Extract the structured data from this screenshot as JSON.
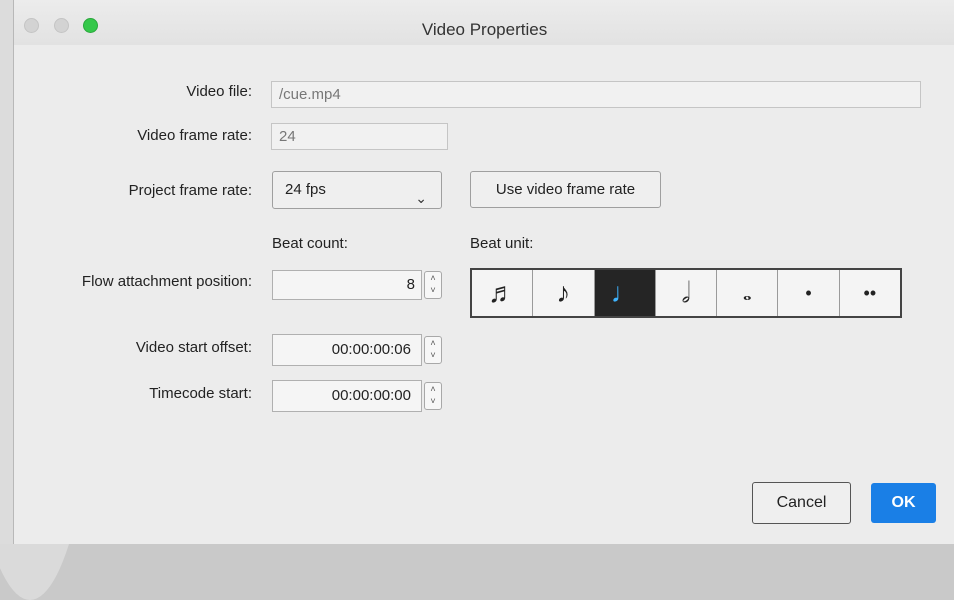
{
  "window": {
    "title": "Video Properties"
  },
  "form": {
    "video_file_label": "Video file:",
    "video_file_value": "/cue.mp4",
    "video_frame_rate_label": "Video frame rate:",
    "video_frame_rate_value": "24",
    "project_frame_rate_label": "Project frame rate:",
    "project_frame_rate_value": "24 fps",
    "use_video_frame_rate_button": "Use video frame rate",
    "beat_count_label": "Beat count:",
    "beat_unit_label": "Beat unit:",
    "flow_attachment_label": "Flow attachment position:",
    "flow_attachment_value": "8",
    "video_start_offset_label": "Video start offset:",
    "video_start_offset_value": "00:00:00:06",
    "timecode_start_label": "Timecode start:",
    "timecode_start_value": "00:00:00:00"
  },
  "beat_units": [
    {
      "name": "sixteenth-note-icon",
      "glyph": "♬",
      "active": false
    },
    {
      "name": "eighth-note-icon",
      "glyph": "♪",
      "active": false
    },
    {
      "name": "quarter-note-icon",
      "glyph": "♩",
      "active": true
    },
    {
      "name": "half-note-icon",
      "glyph": "𝅗𝅥",
      "active": false
    },
    {
      "name": "whole-note-icon",
      "glyph": "𝅝",
      "active": false
    },
    {
      "name": "dot-icon",
      "glyph": "•",
      "active": false
    },
    {
      "name": "double-dot-icon",
      "glyph": "••",
      "active": false
    }
  ],
  "buttons": {
    "cancel": "Cancel",
    "ok": "OK"
  },
  "colors": {
    "accent": "#1a7fe6",
    "active_note": "#3fb4ff",
    "traffic_green": "#35c84a"
  }
}
